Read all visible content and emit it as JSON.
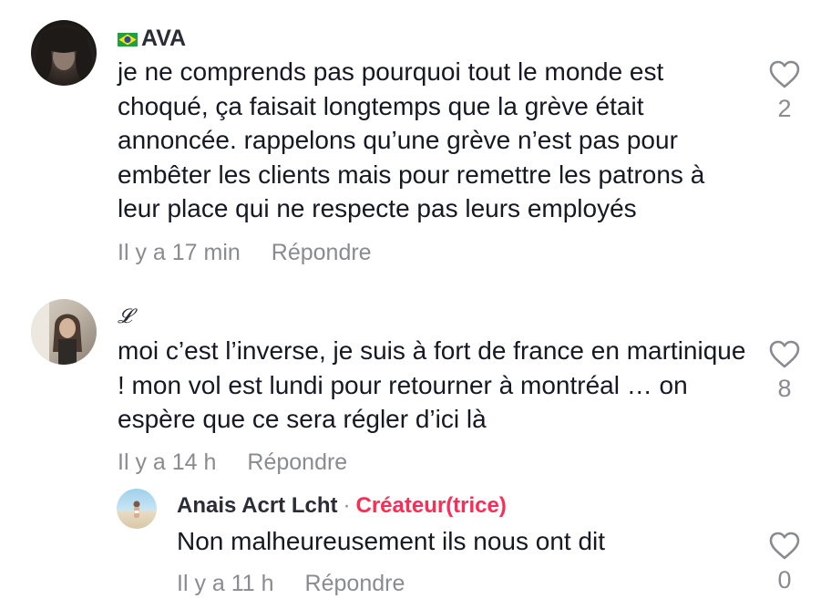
{
  "comments": [
    {
      "username": "AVA",
      "text": "je ne comprends pas pourquoi tout le monde est choqué, ça faisait longtemps que la grève était annoncée. rappelons qu’une grève n’est pas pour embêter les clients mais pour remettre les patrons à leur place qui ne respecte pas leurs employés",
      "time": "Il y a 17 min",
      "reply_label": "Répondre",
      "likes": "2"
    },
    {
      "username": "𝓛",
      "text": "moi c’est l’inverse, je suis à fort de france en martinique ! mon vol est lundi pour retourner à montréal … on espère que ce sera régler d’ici là",
      "time": "Il y a 14 h",
      "reply_label": "Répondre",
      "likes": "8"
    }
  ],
  "reply": {
    "username": "Anais Acrt Lcht",
    "separator": "·",
    "badge": "Créateur(trice)",
    "text": "Non malheureusement ils nous ont dit",
    "time": "Il y a 11 h",
    "reply_label": "Répondre",
    "likes": "0"
  },
  "colors": {
    "text": "#161823",
    "meta": "#8a8b91",
    "creator_badge": "#fe2c55",
    "heart_outline": "#8a8b91"
  },
  "icons": {
    "like": "heart-outline-icon",
    "flag": "brazil-flag-icon"
  }
}
